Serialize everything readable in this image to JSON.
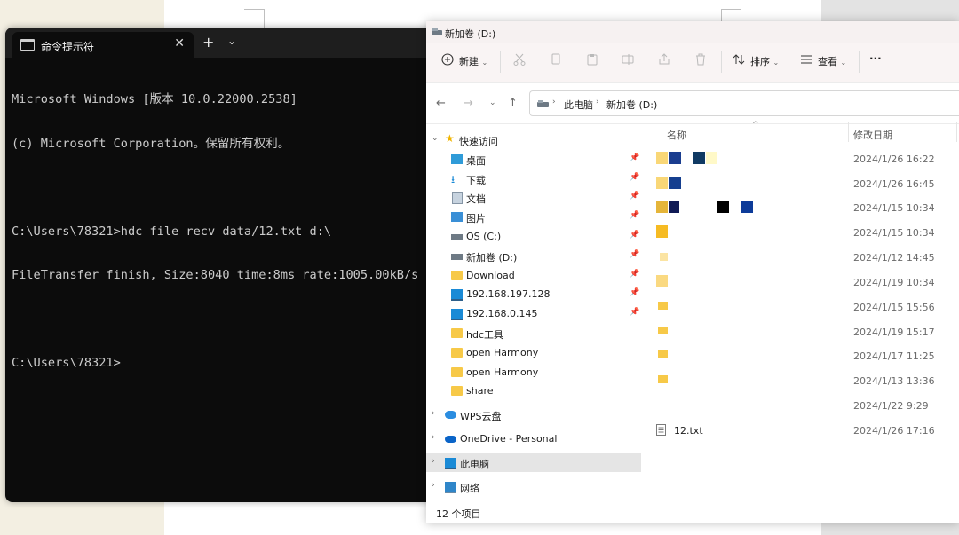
{
  "terminal": {
    "tab_title": "命令提示符",
    "close_glyph": "✕",
    "new_tab_glyph": "+",
    "dropdown_glyph": "⌄",
    "lines": [
      "Microsoft Windows [版本 10.0.22000.2538]",
      "(c) Microsoft Corporation。保留所有权利。",
      "",
      "C:\\Users\\78321>hdc file recv data/12.txt d:\\",
      "FileTransfer finish, Size:8040 time:8ms rate:1005.00kB/s",
      "",
      "C:\\Users\\78321>"
    ]
  },
  "explorer": {
    "title": "新加卷 (D:)",
    "toolbar": {
      "new_label": "新建",
      "sort_label": "排序",
      "view_label": "查看",
      "more_glyph": "···"
    },
    "breadcrumb": [
      "此电脑",
      "新加卷 (D:)"
    ],
    "nav": {
      "quick_access": "快速访问",
      "quick_items": [
        {
          "label": "桌面",
          "icon": "desktop-icon",
          "pinned": true
        },
        {
          "label": "下载",
          "icon": "download-icon",
          "pinned": true
        },
        {
          "label": "文档",
          "icon": "document-icon",
          "pinned": true
        },
        {
          "label": "图片",
          "icon": "picture-icon",
          "pinned": true
        },
        {
          "label": "OS (C:)",
          "icon": "drive-icon",
          "pinned": true
        },
        {
          "label": "新加卷 (D:)",
          "icon": "drive-icon",
          "pinned": true
        },
        {
          "label": "Download",
          "icon": "folder-icon",
          "pinned": true
        },
        {
          "label": "192.168.197.128",
          "icon": "monitor-icon",
          "pinned": true
        },
        {
          "label": "192.168.0.145",
          "icon": "monitor-icon",
          "pinned": true
        },
        {
          "label": "hdc工具",
          "icon": "folder-icon",
          "pinned": false
        },
        {
          "label": "open Harmony",
          "icon": "folder-icon",
          "pinned": false
        },
        {
          "label": "open Harmony",
          "icon": "folder-icon",
          "pinned": false
        },
        {
          "label": "share",
          "icon": "folder-icon",
          "pinned": false
        }
      ],
      "wps": "WPS云盘",
      "onedrive": "OneDrive - Personal",
      "this_pc": "此电脑",
      "network": "网络"
    },
    "columns": {
      "name": "名称",
      "date": "修改日期"
    },
    "files": [
      {
        "name": "",
        "date": "2024/1/26 16:22"
      },
      {
        "name": "",
        "date": "2024/1/26 16:45"
      },
      {
        "name": "",
        "date": "2024/1/15 10:34"
      },
      {
        "name": "",
        "date": "2024/1/15 10:34"
      },
      {
        "name": "",
        "date": "2024/1/12 14:45"
      },
      {
        "name": "",
        "date": "2024/1/19 10:34"
      },
      {
        "name": "",
        "date": "2024/1/15 15:56"
      },
      {
        "name": "",
        "date": "2024/1/19 15:17"
      },
      {
        "name": "",
        "date": "2024/1/17 11:25"
      },
      {
        "name": "",
        "date": "2024/1/13 13:36"
      },
      {
        "name": "",
        "date": "2024/1/22 9:29"
      },
      {
        "name": "12.txt",
        "date": "2024/1/26 17:16"
      }
    ],
    "status": "12 个项目",
    "colors": {
      "folder": "#f7c948",
      "selection": "#e5e5e5",
      "accent": "#0067c0"
    }
  }
}
